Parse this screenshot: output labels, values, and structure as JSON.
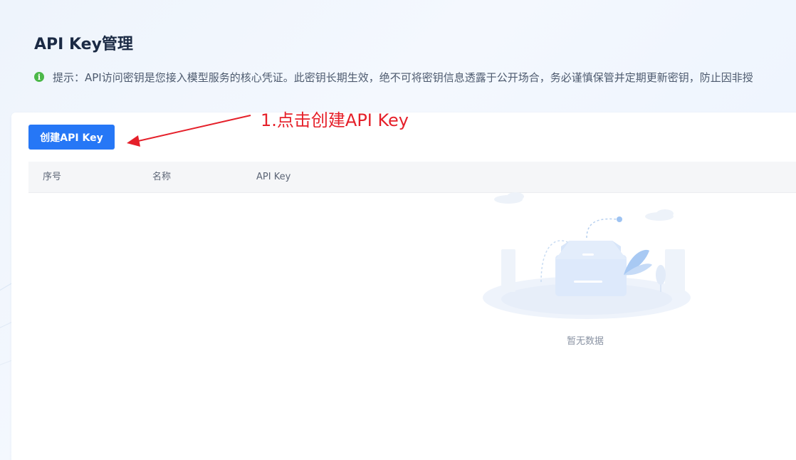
{
  "page": {
    "title": "API Key管理",
    "tip": "提示：API访问密钥是您接入模型服务的核心凭证。此密钥长期生效，绝不可将密钥信息透露于公开场合，务必谨慎保管并定期更新密钥，防止因非授"
  },
  "toolbar": {
    "create_label": "创建API Key"
  },
  "annotation": {
    "text": "1.点击创建API Key",
    "color": "#e5202a"
  },
  "table": {
    "columns": [
      "序号",
      "名称",
      "API Key"
    ],
    "rows": [],
    "empty_text": "暂无数据"
  },
  "icons": {
    "tip": "info-icon",
    "empty": "empty-box-icon"
  },
  "colors": {
    "primary": "#2677f6",
    "info": "#4cb849",
    "title": "#1b2a44"
  }
}
